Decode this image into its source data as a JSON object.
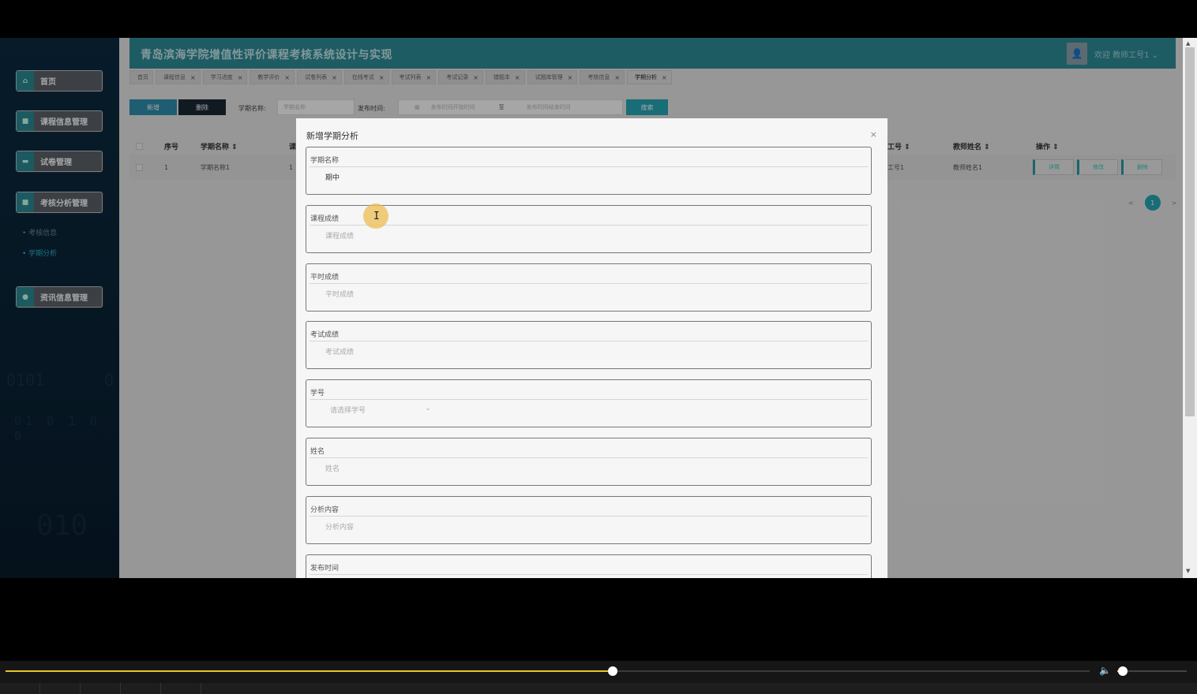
{
  "app": {
    "title": "青岛滨海学院增值性评价课程考核系统设计与实现",
    "welcome": "欢迎 教师工号1 ⌄",
    "avatar_icon": "user-avatar"
  },
  "sidebar": {
    "items": [
      {
        "label": "首页",
        "icon": "home-icon"
      },
      {
        "label": "课程信息管理",
        "icon": "course-icon"
      },
      {
        "label": "试卷管理",
        "icon": "paper-icon"
      },
      {
        "label": "考核分析管理",
        "icon": "analysis-icon"
      },
      {
        "label": "资讯信息管理",
        "icon": "news-icon"
      }
    ],
    "subitems": [
      {
        "label": "• 考核信息",
        "active": false
      },
      {
        "label": "• 学期分析",
        "active": true
      }
    ],
    "decor": [
      "0101",
      "0",
      "01 0 1 0 0",
      "010"
    ]
  },
  "tabs": [
    {
      "label": "首页",
      "closable": false
    },
    {
      "label": "课程信息",
      "closable": true
    },
    {
      "label": "学习进度",
      "closable": true
    },
    {
      "label": "教学评价",
      "closable": true
    },
    {
      "label": "试卷列表",
      "closable": true
    },
    {
      "label": "在线考试",
      "closable": true
    },
    {
      "label": "考试列表",
      "closable": true
    },
    {
      "label": "考试记录",
      "closable": true
    },
    {
      "label": "错题本",
      "closable": true
    },
    {
      "label": "试题库管理",
      "closable": true
    },
    {
      "label": "考核信息",
      "closable": true
    },
    {
      "label": "学期分析",
      "closable": true,
      "active": true
    }
  ],
  "toolbar": {
    "add_label": "新增",
    "delete_label": "删除",
    "term_label": "学期名称:",
    "term_placeholder": "学期名称",
    "publish_label": "发布时间:",
    "start_placeholder": "发布时间开始时间",
    "to_label": "至",
    "end_placeholder": "发布时间结束时间",
    "search_label": "搜索"
  },
  "table": {
    "headers": [
      "序号",
      "学期名称 ⇕",
      "课",
      "工号 ⇕",
      "教师姓名 ⇕",
      "操作 ⇕"
    ],
    "rows": [
      {
        "index": "1",
        "term": "学期名称1",
        "course": "1",
        "teacher_id": "工号1",
        "teacher_name": "教师姓名1"
      }
    ],
    "actions": [
      "详情",
      "修改",
      "删除"
    ]
  },
  "pagination": {
    "prev": "<",
    "current": "1",
    "next": ">"
  },
  "modal": {
    "title": "新增学期分析",
    "close": "×",
    "fields": [
      {
        "label": "学期名称",
        "value": "期中",
        "placeholder": ""
      },
      {
        "label": "课程成绩",
        "value": "",
        "placeholder": "课程成绩"
      },
      {
        "label": "平时成绩",
        "value": "",
        "placeholder": "平时成绩"
      },
      {
        "label": "考试成绩",
        "value": "",
        "placeholder": "考试成绩"
      },
      {
        "label": "学号",
        "value": "",
        "placeholder": "请选择学号",
        "select": true
      },
      {
        "label": "姓名",
        "value": "",
        "placeholder": "姓名"
      },
      {
        "label": "分析内容",
        "value": "",
        "placeholder": "分析内容"
      },
      {
        "label": "发布时间",
        "value": "",
        "placeholder": ""
      }
    ]
  },
  "player": {
    "progress": 0.56,
    "volume": 0.08,
    "accent": "#e8c52a"
  },
  "colors": {
    "brand": "#2f8e9a",
    "accent": "#25a8b7",
    "sidebar": "#0c2a40"
  }
}
